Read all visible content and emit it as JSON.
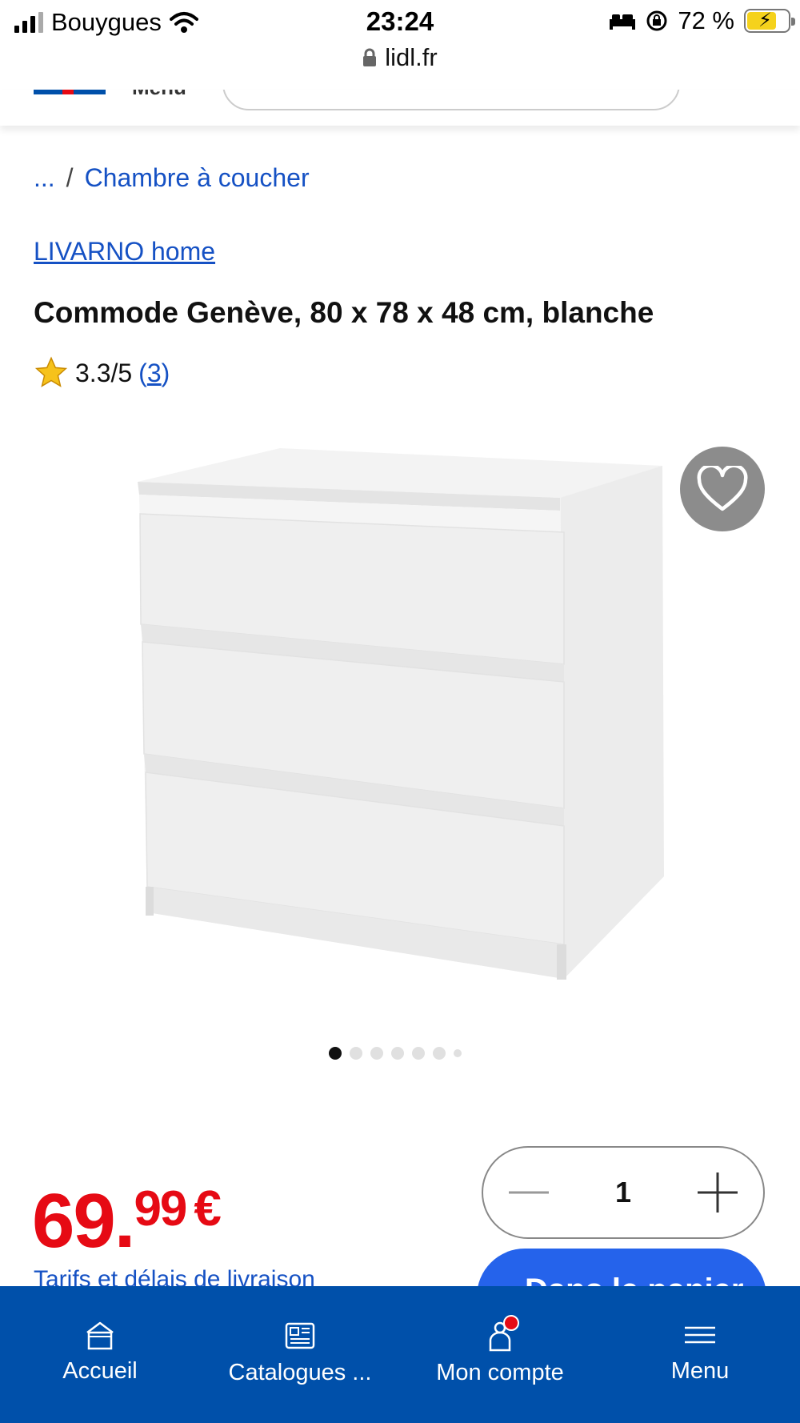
{
  "status_bar": {
    "carrier": "Bouygues",
    "time": "23:24",
    "url": "lidl.fr",
    "battery": "72 %"
  },
  "header": {
    "menu_label": "Menu"
  },
  "breadcrumb": {
    "ellipsis": "...",
    "separator": "/",
    "current": "Chambre à coucher"
  },
  "product": {
    "brand": "LIVARNO home",
    "title": "Commode Genève, 80 x 78 x 48 cm, blanche",
    "rating": "3.3/5",
    "rating_open": "(",
    "rating_count": "3",
    "rating_close": ")",
    "rating_value": 3.3,
    "image_count": 7,
    "active_image": 1,
    "price_int": "69.",
    "price_dec": "99",
    "currency": "€",
    "shipping_link": "Tarifs et délais de livraison",
    "quantity": "1",
    "add_to_cart": "Dans le panier"
  },
  "bottom_nav": {
    "items": [
      {
        "label": "Accueil",
        "icon": "home-icon"
      },
      {
        "label": "Catalogues ...",
        "icon": "catalog-icon"
      },
      {
        "label": "Mon compte",
        "icon": "account-icon"
      },
      {
        "label": "Menu",
        "icon": "menu-icon"
      }
    ]
  },
  "colors": {
    "lidl_blue": "#0050aa",
    "link_blue": "#1551c4",
    "price_red": "#e60a14",
    "cta_blue": "#2563eb",
    "star_yellow": "#f6c21b"
  }
}
